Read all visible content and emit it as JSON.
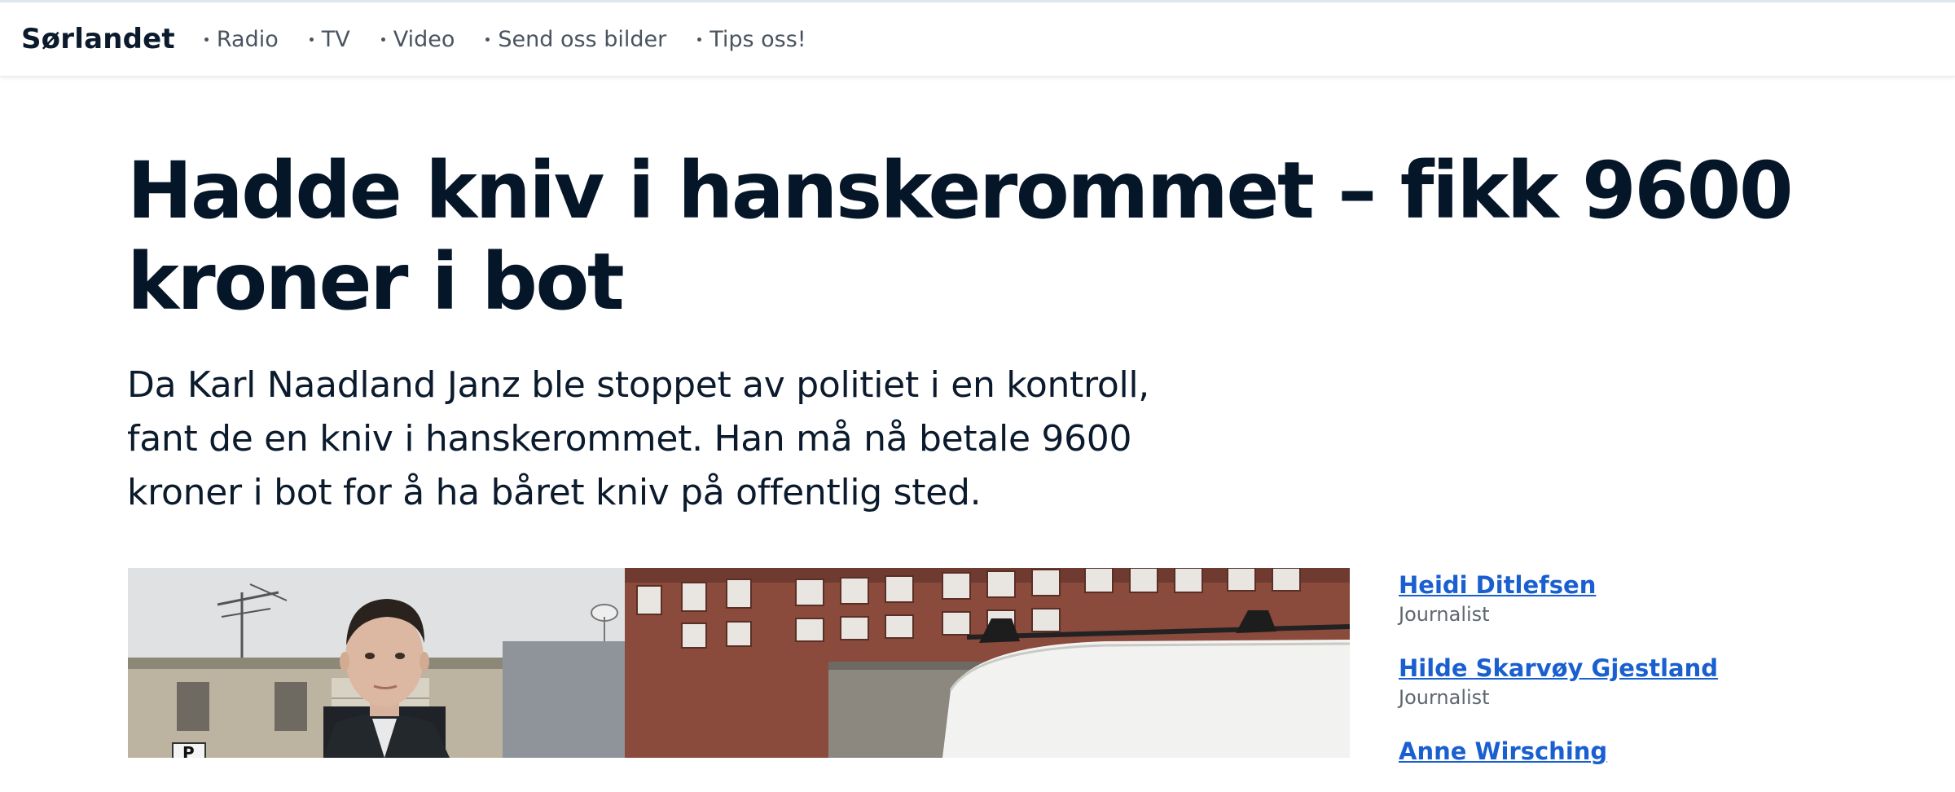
{
  "header": {
    "brand": "Sørlandet",
    "nav": [
      {
        "label": "Radio"
      },
      {
        "label": "TV"
      },
      {
        "label": "Video"
      },
      {
        "label": "Send oss bilder"
      },
      {
        "label": "Tips oss!"
      }
    ]
  },
  "article": {
    "headline": "Hadde kniv i hanskerommet – fikk 9600 kroner i bot",
    "lead": "Da Karl Naadland Janz ble stoppet av politiet i en kontroll, fant de en kniv i hanskerommet. Han må nå betale 9600 kroner i bot for å ha båret kniv på offentlig sted.",
    "image_sign_letter": "P"
  },
  "bylines": [
    {
      "name": "Heidi Ditlefsen",
      "role": "Journalist"
    },
    {
      "name": "Hilde Skarvøy Gjestland",
      "role": "Journalist"
    },
    {
      "name": "Anne Wirsching",
      "role": ""
    }
  ],
  "colors": {
    "text": "#061629",
    "link": "#1a5fd0",
    "muted": "#5e6670"
  }
}
